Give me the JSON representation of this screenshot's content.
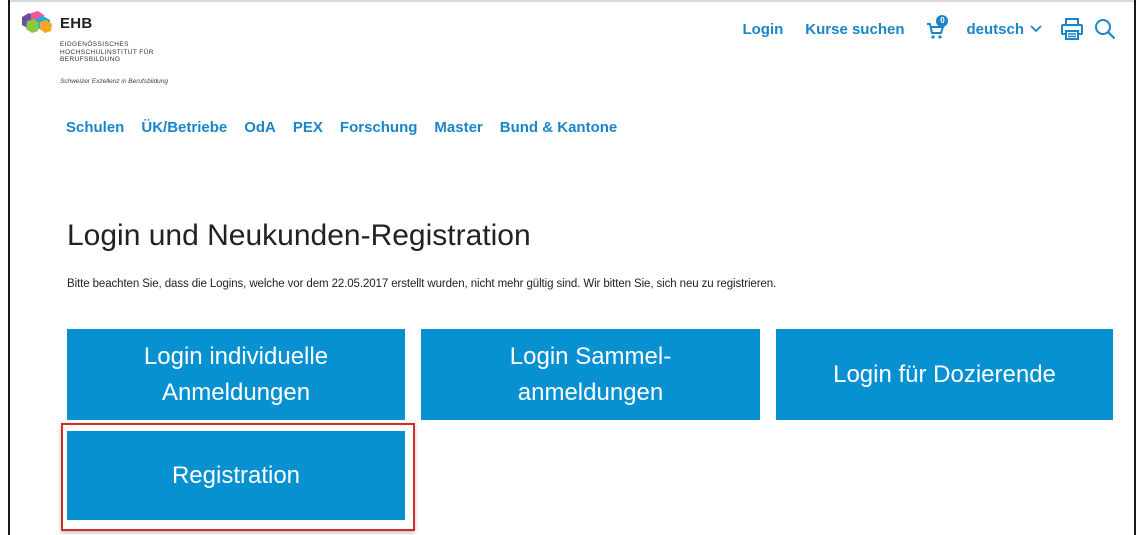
{
  "logo": {
    "name": "EHB",
    "lines": [
      "EIDGENÖSSISCHES",
      "HOCHSCHULINSTITUT FÜR",
      "BERUFSBILDUNG"
    ],
    "tagline": "Schweizer Exzellenz in Berufsbildung"
  },
  "util_nav": {
    "login": "Login",
    "courses": "Kurse suchen",
    "cart_count": "0",
    "language": "deutsch"
  },
  "main_nav": [
    "Schulen",
    "ÜK/Betriebe",
    "OdA",
    "PEX",
    "Forschung",
    "Master",
    "Bund & Kantone"
  ],
  "page": {
    "title": "Login und Neukunden-Registration",
    "notice": "Bitte beachten Sie, dass die Logins, welche vor dem 22.05.2017 erstellt wurden, nicht mehr gültig sind. Wir bitten Sie, sich neu zu registrieren."
  },
  "tiles": {
    "individual": "Login individuelle Anmeldungen",
    "collective": "Login Sammel-anmeldungen",
    "lecturers": "Login für Dozierende",
    "registration": "Registration"
  },
  "colors": {
    "accent": "#1a85c8",
    "tile": "#0891d1",
    "highlight": "#d42a2a"
  }
}
